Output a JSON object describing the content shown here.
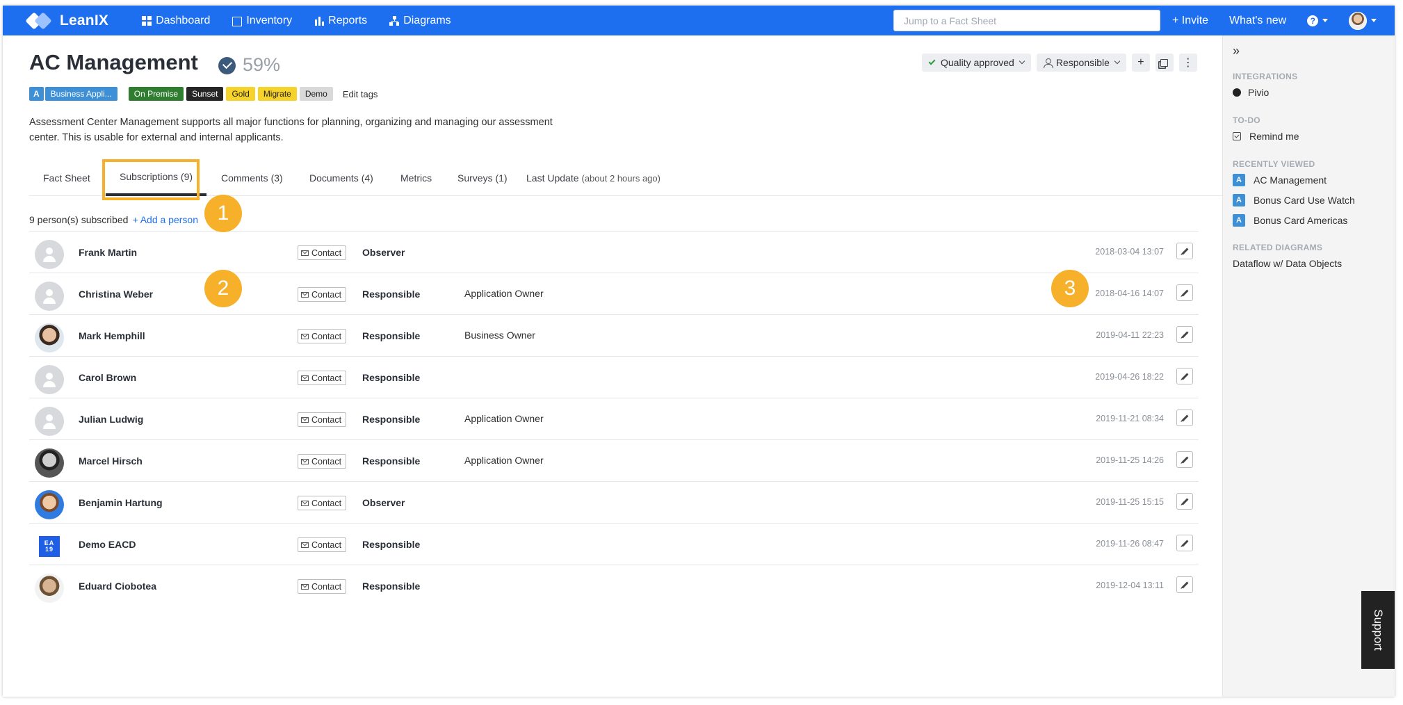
{
  "topbar": {
    "brand": "LeanIX",
    "nav": [
      {
        "label": "Dashboard",
        "icon": "grid-icon"
      },
      {
        "label": "Inventory",
        "icon": "inventory-icon"
      },
      {
        "label": "Reports",
        "icon": "reports-icon"
      },
      {
        "label": "Diagrams",
        "icon": "diagrams-icon"
      }
    ],
    "search_placeholder": "Jump to a Fact Sheet",
    "invite": "+ Invite",
    "whats_new": "What's new",
    "help": "?"
  },
  "factsheet": {
    "title": "AC Management",
    "completion": "59%",
    "tags": {
      "type_letter": "A",
      "type": "Business Appli...",
      "items": [
        "On Premise",
        "Sunset",
        "Gold",
        "Migrate",
        "Demo"
      ],
      "edit": "Edit tags"
    },
    "description": "Assessment Center Management supports all major functions for planning, organizing and managing our assessment center. This is usable for external and internal applicants.",
    "quality": "Quality approved",
    "responsible": "Responsible",
    "add": "+",
    "more": "⋮"
  },
  "tabs": [
    {
      "label": "Fact Sheet",
      "extra": ""
    },
    {
      "label": "Subscriptions (9)",
      "extra": ""
    },
    {
      "label": "Comments (3)",
      "extra": ""
    },
    {
      "label": "Documents (4)",
      "extra": ""
    },
    {
      "label": "Metrics",
      "extra": ""
    },
    {
      "label": "Surveys (1)",
      "extra": ""
    },
    {
      "label": "Last Update",
      "extra": "(about 2 hours ago)"
    }
  ],
  "subscriptions": {
    "count_text": "9 person(s) subscribed",
    "add_person": "+ Add a person",
    "contact_label": "Contact",
    "rows": [
      {
        "name": "Frank Martin",
        "type": "Observer",
        "role": "",
        "date": "2018-03-04 13:07"
      },
      {
        "name": "Christina Weber",
        "type": "Responsible",
        "role": "Application Owner",
        "date": "2018-04-16 14:07"
      },
      {
        "name": "Mark Hemphill",
        "type": "Responsible",
        "role": "Business Owner",
        "date": "2019-04-11 22:23"
      },
      {
        "name": "Carol Brown",
        "type": "Responsible",
        "role": "",
        "date": "2019-04-26 18:22"
      },
      {
        "name": "Julian Ludwig",
        "type": "Responsible",
        "role": "Application Owner",
        "date": "2019-11-21 08:34"
      },
      {
        "name": "Marcel Hirsch",
        "type": "Responsible",
        "role": "Application Owner",
        "date": "2019-11-25 14:26"
      },
      {
        "name": "Benjamin Hartung",
        "type": "Observer",
        "role": "",
        "date": "2019-11-25 15:15"
      },
      {
        "name": "Demo EACD",
        "type": "Responsible",
        "role": "",
        "date": "2019-11-26 08:47"
      },
      {
        "name": "Eduard Ciobotea",
        "type": "Responsible",
        "role": "",
        "date": "2019-12-04 13:11"
      }
    ]
  },
  "callouts": [
    "1",
    "2",
    "3"
  ],
  "sidebar": {
    "integrations_h": "INTEGRATIONS",
    "integration": "Pivio",
    "todo_h": "TO-DO",
    "remind": "Remind me",
    "recent_h": "RECENTLY VIEWED",
    "recent": [
      {
        "badge": "A",
        "label": "AC Management"
      },
      {
        "badge": "A",
        "label": "Bonus Card Use Watch"
      },
      {
        "badge": "A",
        "label": "Bonus Card Americas"
      }
    ],
    "diagrams_h": "RELATED DIAGRAMS",
    "diagram": "Dataflow w/ Data Objects",
    "support": "Support"
  }
}
